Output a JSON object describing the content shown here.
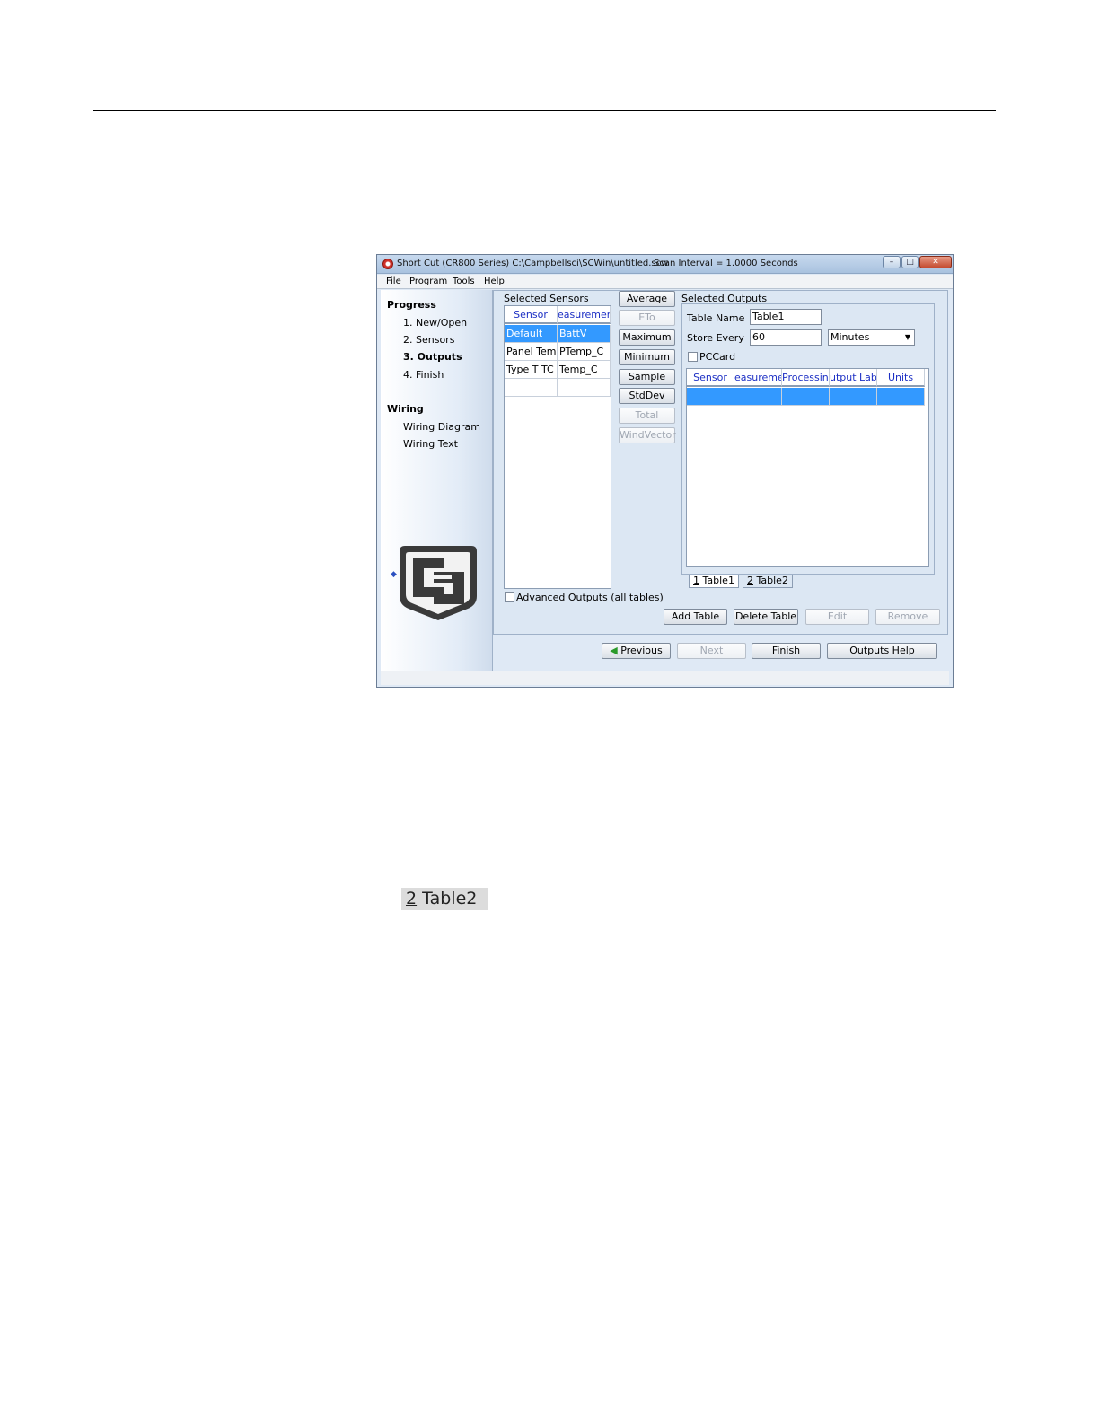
{
  "window": {
    "title": "Short Cut (CR800 Series) C:\\Campbellsci\\SCWin\\untitled.scw",
    "scan_interval": "Scan Interval = 1.0000 Seconds"
  },
  "menu": [
    "File",
    "Program",
    "Tools",
    "Help"
  ],
  "progress": {
    "heading": "Progress",
    "steps": [
      "1. New/Open",
      "2. Sensors",
      "3. Outputs",
      "4. Finish"
    ],
    "active_step": "3. Outputs"
  },
  "wiring": {
    "heading": "Wiring",
    "items": [
      "Wiring Diagram",
      "Wiring Text"
    ]
  },
  "selected_sensors": {
    "label": "Selected Sensors",
    "columns": [
      "Sensor",
      "easuremer"
    ],
    "rows": [
      [
        "Default",
        "BattV"
      ],
      [
        "Panel Tem",
        "PTemp_C"
      ],
      [
        "Type T TC",
        "Temp_C"
      ]
    ]
  },
  "processing_buttons": [
    "Average",
    "ETo",
    "Maximum",
    "Minimum",
    "Sample",
    "StdDev",
    "Total",
    "WindVector"
  ],
  "selected_outputs": {
    "label": "Selected Outputs",
    "table_name_label": "Table Name",
    "table_name_value": "Table1",
    "store_every_label": "Store Every",
    "store_every_value": "60",
    "store_every_unit": "Minutes",
    "pccard_label": "PCCard",
    "columns": [
      "Sensor",
      "easureme",
      "Processing",
      "utput Lab",
      "Units"
    ],
    "tabs": [
      {
        "num": "1",
        "name": "Table1"
      },
      {
        "num": "2",
        "name": "Table2"
      }
    ]
  },
  "advanced_outputs_label": "Advanced Outputs (all tables)",
  "table_buttons": [
    "Add Table",
    "Delete Table",
    "Edit",
    "Remove"
  ],
  "nav_buttons": {
    "previous": "Previous",
    "next": "Next",
    "finish": "Finish",
    "help": "Outputs Help"
  },
  "tab_image": {
    "num": "2",
    "name": "Table2"
  }
}
